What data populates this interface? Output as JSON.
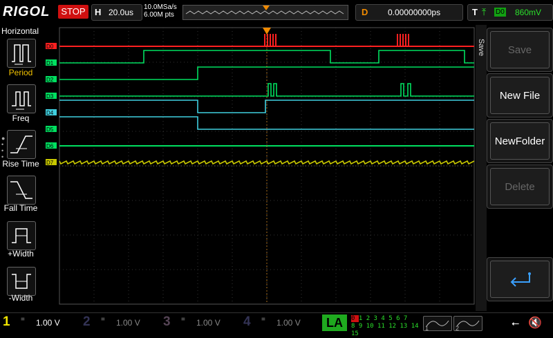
{
  "app": {
    "brand": "RIGOL",
    "run_state": "STOP"
  },
  "horizontal": {
    "key": "H",
    "timebase": "20.0us",
    "sample_rate": "10.0MSa/s",
    "memory_depth": "6.00M pts"
  },
  "delay": {
    "key": "D",
    "value": "0.00000000ps"
  },
  "trigger": {
    "key": "T",
    "slope_icon": "rising-edge-icon",
    "source": "D0",
    "level": "860mV"
  },
  "left_menu": {
    "title": "Horizontal",
    "items": [
      {
        "label": "Period",
        "icon": "period-icon"
      },
      {
        "label": "Freq",
        "icon": "freq-icon"
      },
      {
        "label": "Rise Time",
        "icon": "rise-time-icon"
      },
      {
        "label": "Fall Time",
        "icon": "fall-time-icon"
      },
      {
        "label": "+Width",
        "icon": "positive-width-icon"
      },
      {
        "label": "-Width",
        "icon": "negative-width-icon"
      }
    ]
  },
  "right_menu": {
    "title": "Save",
    "buttons": [
      {
        "label": "Save",
        "enabled": false
      },
      {
        "label": "New File",
        "enabled": true
      },
      {
        "label": "NewFolder",
        "enabled": true
      },
      {
        "label": "Delete",
        "enabled": false
      },
      {
        "label": "",
        "icon": "return-icon",
        "enabled": true
      }
    ]
  },
  "channels": [
    {
      "num": "1",
      "coupling": "=",
      "scale": "1.00 V",
      "color": "#f2e600"
    },
    {
      "num": "2",
      "coupling": "=",
      "scale": "1.00 V",
      "color": "#00c8ff"
    },
    {
      "num": "3",
      "coupling": "=",
      "scale": "1.00 V",
      "color": "#e040e0"
    },
    {
      "num": "4",
      "coupling": "=",
      "scale": "1.00 V",
      "color": "#2060ff"
    }
  ],
  "la": {
    "label": "LA",
    "row1": [
      "0",
      "1",
      "2",
      "3",
      "4",
      "5",
      "6",
      "7"
    ],
    "row2": [
      "8",
      "9",
      "10",
      "11",
      "12",
      "13",
      "14",
      "15"
    ]
  },
  "slots": [
    {
      "n": "1"
    },
    {
      "n": "2"
    }
  ],
  "digital": {
    "labels": [
      "D0",
      "D1",
      "D2",
      "D3",
      "D4",
      "D5",
      "D6",
      "D7"
    ],
    "colors": {
      "d0": "#ff2020",
      "low": "#00e060",
      "high": "#40d0e0",
      "d7": "#c8c800"
    }
  },
  "status_icons": {
    "usb": "usb-icon",
    "speaker": "speaker-muted-icon"
  }
}
